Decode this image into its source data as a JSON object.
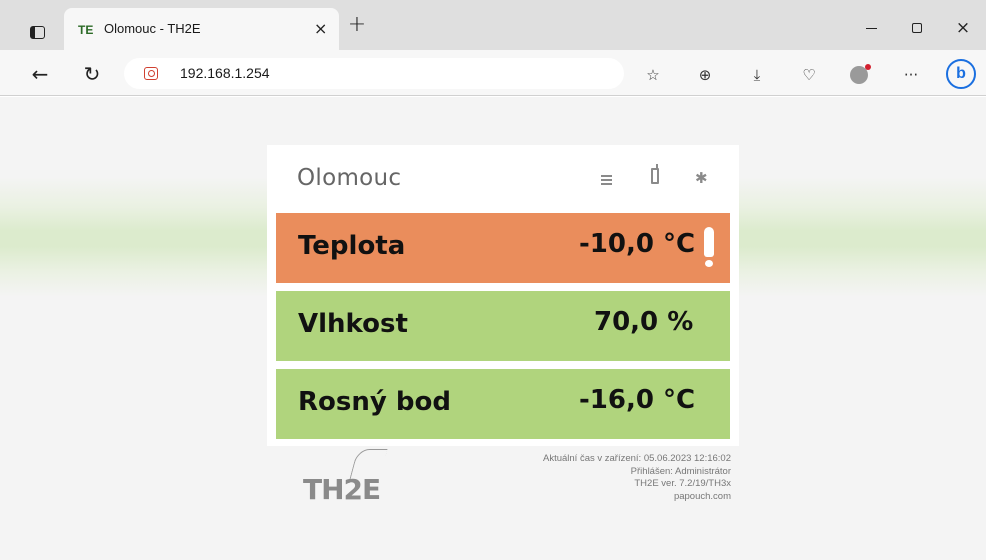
{
  "browser": {
    "tab_title": "Olomouc - TH2E",
    "tab_favicon": "TE",
    "new_tab_label": "+",
    "close_tab_label": "×",
    "url": "192.168.1.254",
    "window_close_label": "×",
    "more_label": "···"
  },
  "page": {
    "station_name": "Olomouc",
    "rows": [
      {
        "label": "Teplota",
        "value": "-10,0 °C",
        "color": "#ea8d5c",
        "alert": true
      },
      {
        "label": "Vlhkost",
        "value": "70,0 %",
        "color": "#b0d47d",
        "alert": false
      },
      {
        "label": "Rosný bod",
        "value": "-16,0 °C",
        "color": "#b0d47d",
        "alert": false
      }
    ],
    "footer": {
      "logo": "TH2E",
      "device_time": "Aktuální čas v zařízení: 05.06.2023 12:16:02",
      "logged_in": "Přihlášen: Administrátor",
      "version": "TH2E ver. 7.2/19/TH3x",
      "website": "papouch.com"
    }
  },
  "icons": {
    "sidebar": "sidebar-icon",
    "back": "back-arrow-icon",
    "refresh": "refresh-icon",
    "favorites": "favorites-star-icon",
    "collections": "collections-icon",
    "downloads": "download-icon",
    "health": "browser-essentials-icon",
    "profile": "profile-avatar-icon",
    "copilot": "bing-copilot-icon",
    "menu": "menu-icon",
    "mobile": "mobile-phone-icon",
    "settings": "gear-icon"
  }
}
